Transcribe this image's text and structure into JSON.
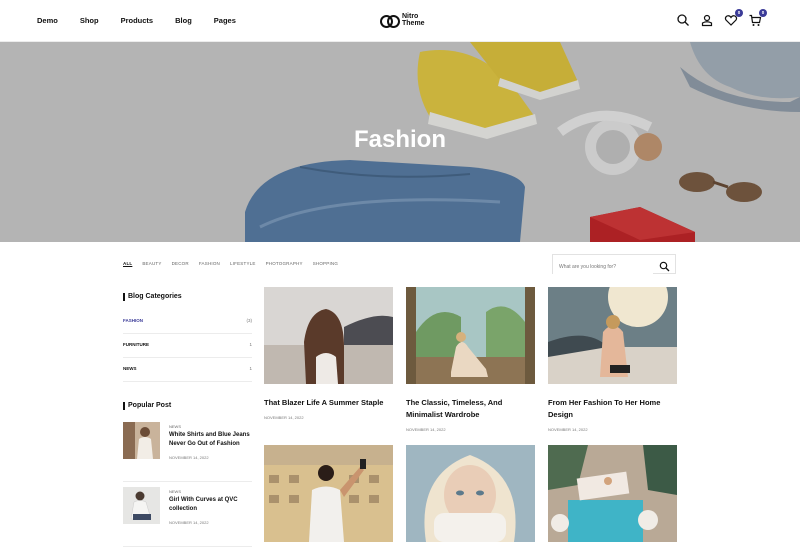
{
  "nav": {
    "items": [
      "Demo",
      "Shop",
      "Products",
      "Blog",
      "Pages"
    ]
  },
  "logo": {
    "line1": "Nitro",
    "line2": "Theme"
  },
  "header_icons": {
    "wishlist_count": "0",
    "cart_count": "0"
  },
  "hero": {
    "title": "Fashion"
  },
  "filters": [
    "ALL",
    "BEAUTY",
    "DECOR",
    "FASHION",
    "LIFESTYLE",
    "PHOTOGRAPHY",
    "SHOPPING"
  ],
  "search": {
    "placeholder": "What are you looking for?"
  },
  "sidebar": {
    "categories_heading": "Blog Categories",
    "categories": [
      {
        "label": "FASHION",
        "count": "(3)"
      },
      {
        "label": "FURNITURE",
        "count": "1"
      },
      {
        "label": "NEWS",
        "count": "1"
      }
    ],
    "popular_heading": "Popular Post",
    "popular": [
      {
        "tag": "NEWS",
        "title": "White Shirts and Blue Jeans Never Go Out of Fashion",
        "date": "NOVEMBER 14, 2022"
      },
      {
        "tag": "NEWS",
        "title": "Girl With Curves at QVC collection",
        "date": "NOVEMBER 14, 2022"
      }
    ]
  },
  "posts": [
    {
      "title": "That Blazer Life A Summer Staple",
      "date": "NOVEMBER 14, 2022"
    },
    {
      "title": "The Classic, Timeless, And Minimalist Wardrobe",
      "date": "NOVEMBER 14, 2022"
    },
    {
      "title": "From Her Fashion To Her Home Design",
      "date": "NOVEMBER 14, 2022"
    },
    {
      "title": "",
      "date": ""
    },
    {
      "title": "",
      "date": ""
    },
    {
      "title": "",
      "date": ""
    }
  ],
  "colors": {
    "accent": "#3b3b98",
    "border": "#ececec",
    "text": "#111111"
  }
}
